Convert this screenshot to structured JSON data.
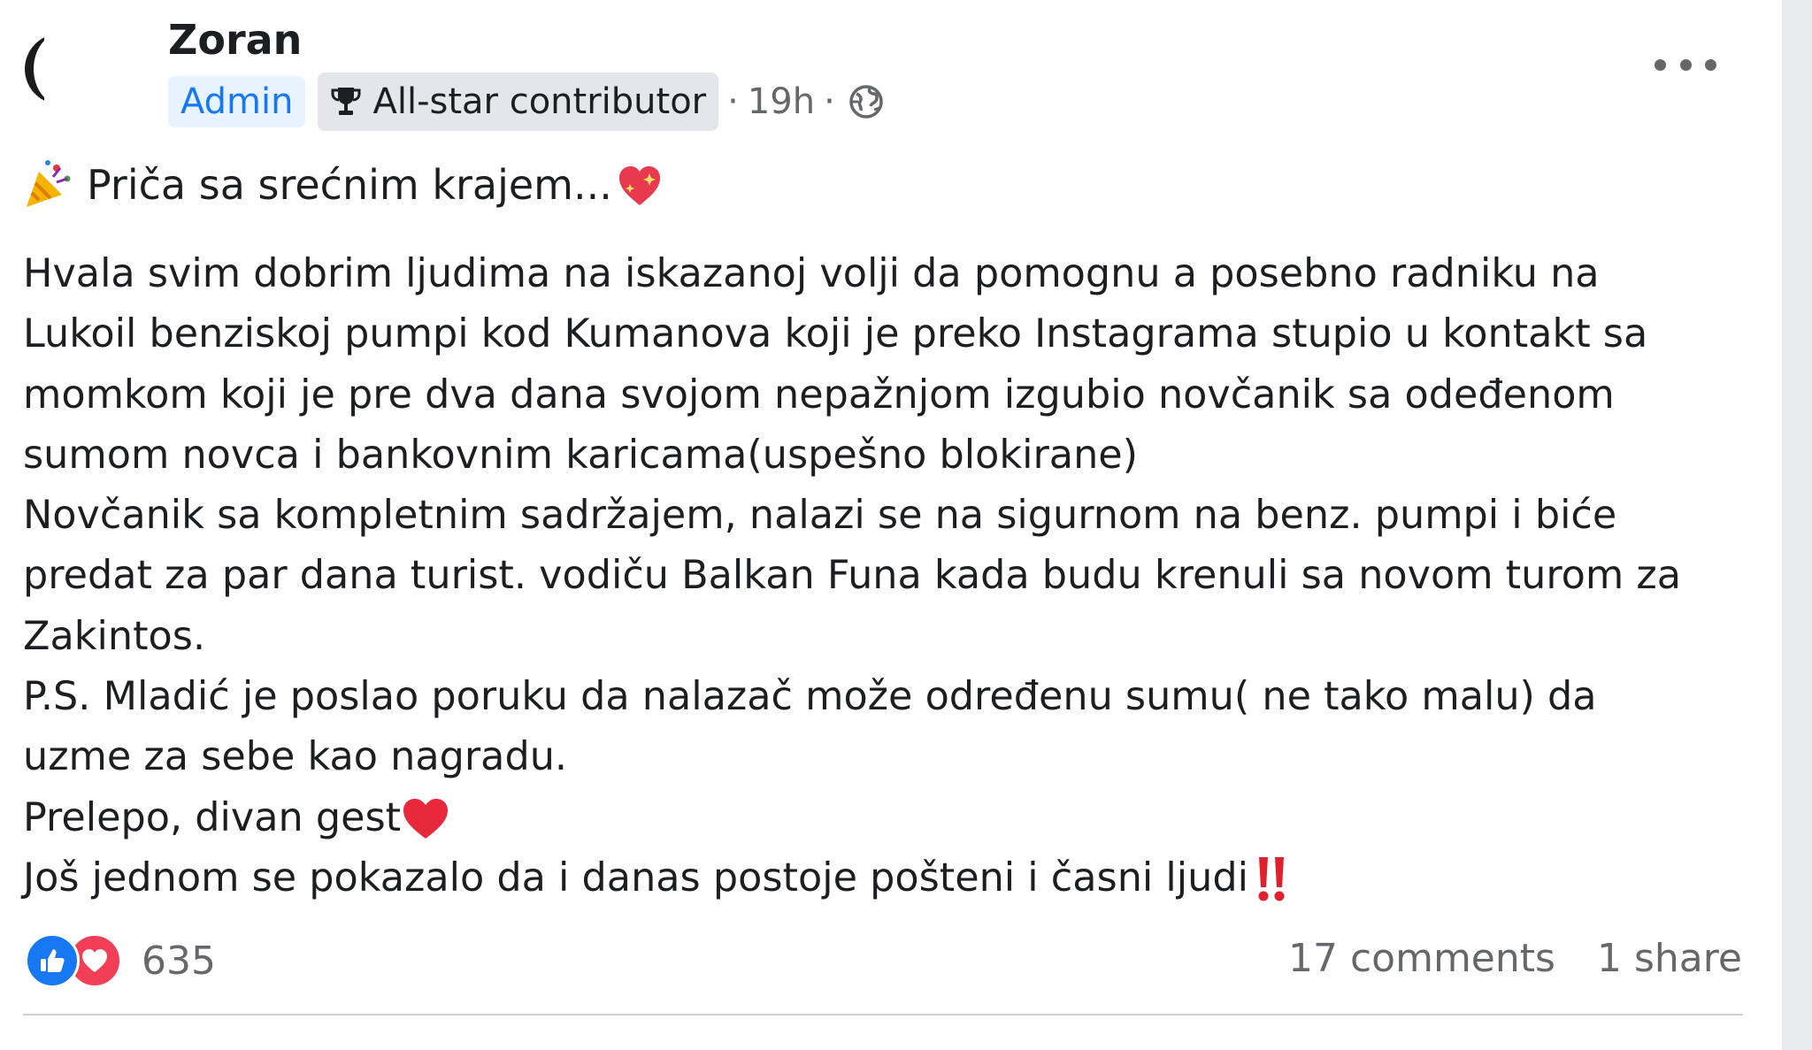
{
  "post": {
    "author": "Zoran",
    "badges": {
      "admin": "Admin",
      "allstar": "All-star contributor"
    },
    "separator": "·",
    "time": "19h",
    "privacy_icon": "globe-icon",
    "title": "Priča sa srećnim krajem...",
    "body_lines": [
      "Hvala svim dobrim ljudima na iskazanoj volji da pomognu a posebno radniku na",
      "Lukoil benziskoj pumpi kod Kumanova koji je preko Instagrama stupio u kontakt sa",
      "momkom koji je pre dva dana svojom nepažnjom izgubio novčanik sa odeđenom",
      "sumom novca i bankovnim karicama(uspešno blokirane)",
      "Novčanik sa kompletnim sadržajem, nalazi se na sigurnom na benz. pumpi i biće",
      "predat za par dana turist. vodiču Balkan Funa kada budu krenuli sa novom turom za",
      "Zakintos.",
      "P.S. Mladić je poslao poruku da nalazač može određenu sumu( ne tako malu) da",
      "uzme za sebe kao nagradu.",
      "Prelepo, divan gest",
      "Još jednom se pokazalo da i danas postoje pošteni i časni ljudi"
    ]
  },
  "footer": {
    "reaction_count": "635",
    "comments": "17 comments",
    "shares": "1 share"
  },
  "colors": {
    "brand_blue": "#1877f2",
    "love_red": "#f33e58",
    "secondary_text": "#65676b"
  }
}
